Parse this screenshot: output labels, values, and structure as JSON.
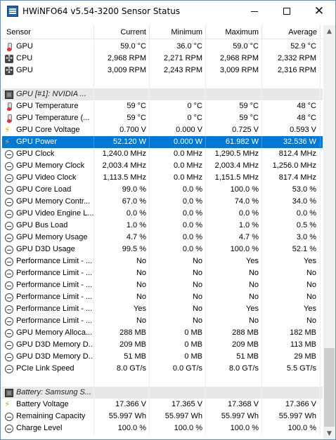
{
  "window": {
    "title": "HWiNFO64 v5.54-3200 Sensor Status"
  },
  "columns": {
    "sensor": "Sensor",
    "current": "Current",
    "minimum": "Minimum",
    "maximum": "Maximum",
    "average": "Average"
  },
  "rows": [
    {
      "type": "data",
      "icon": "thermometer-icon",
      "name": "GPU",
      "current": "59.0 °C",
      "minimum": "36.0 °C",
      "maximum": "59.0 °C",
      "average": "52.9 °C"
    },
    {
      "type": "data",
      "icon": "fan-icon",
      "name": "CPU",
      "current": "2,968 RPM",
      "minimum": "2,271 RPM",
      "maximum": "2,968 RPM",
      "average": "2,332 RPM"
    },
    {
      "type": "data",
      "icon": "fan-icon",
      "name": "GPU",
      "current": "3,009 RPM",
      "minimum": "2,243 RPM",
      "maximum": "3,009 RPM",
      "average": "2,316 RPM"
    },
    {
      "type": "spacer"
    },
    {
      "type": "group",
      "icon": "chip-icon",
      "name": "GPU [#1]: NVIDIA ..."
    },
    {
      "type": "data",
      "icon": "thermometer-icon",
      "name": "GPU Temperature",
      "current": "59 °C",
      "minimum": "0 °C",
      "maximum": "59 °C",
      "average": "48 °C"
    },
    {
      "type": "data",
      "icon": "thermometer-icon",
      "name": "GPU Temperature (...",
      "current": "59 °C",
      "minimum": "0 °C",
      "maximum": "59 °C",
      "average": "48 °C"
    },
    {
      "type": "data",
      "icon": "bolt-icon",
      "name": "GPU Core Voltage",
      "current": "0.700 V",
      "minimum": "0.000 V",
      "maximum": "0.725 V",
      "average": "0.593 V"
    },
    {
      "type": "data",
      "icon": "bolt-icon",
      "name": "GPU Power",
      "current": "52.120 W",
      "minimum": "0.000 W",
      "maximum": "61.982 W",
      "average": "32.536 W",
      "selected": true
    },
    {
      "type": "data",
      "icon": "gauge-icon",
      "name": "GPU Clock",
      "current": "1,240.0 MHz",
      "minimum": "0.0 MHz",
      "maximum": "1,290.5 MHz",
      "average": "812.4 MHz"
    },
    {
      "type": "data",
      "icon": "gauge-icon",
      "name": "GPU Memory Clock",
      "current": "2,003.4 MHz",
      "minimum": "0.0 MHz",
      "maximum": "2,003.4 MHz",
      "average": "1,256.0 MHz"
    },
    {
      "type": "data",
      "icon": "gauge-icon",
      "name": "GPU Video Clock",
      "current": "1,113.5 MHz",
      "minimum": "0.0 MHz",
      "maximum": "1,151.5 MHz",
      "average": "817.4 MHz"
    },
    {
      "type": "data",
      "icon": "gauge-icon",
      "name": "GPU Core Load",
      "current": "99.0 %",
      "minimum": "0.0 %",
      "maximum": "100.0 %",
      "average": "53.0 %"
    },
    {
      "type": "data",
      "icon": "gauge-icon",
      "name": "GPU Memory Contr...",
      "current": "67.0 %",
      "minimum": "0.0 %",
      "maximum": "74.0 %",
      "average": "34.0 %"
    },
    {
      "type": "data",
      "icon": "gauge-icon",
      "name": "GPU Video Engine L...",
      "current": "0.0 %",
      "minimum": "0.0 %",
      "maximum": "0.0 %",
      "average": "0.0 %"
    },
    {
      "type": "data",
      "icon": "gauge-icon",
      "name": "GPU Bus Load",
      "current": "1.0 %",
      "minimum": "0.0 %",
      "maximum": "1.0 %",
      "average": "0.5 %"
    },
    {
      "type": "data",
      "icon": "gauge-icon",
      "name": "GPU Memory Usage",
      "current": "4.7 %",
      "minimum": "0.0 %",
      "maximum": "4.7 %",
      "average": "3.0 %"
    },
    {
      "type": "data",
      "icon": "gauge-icon",
      "name": "GPU D3D Usage",
      "current": "99.5 %",
      "minimum": "0.0 %",
      "maximum": "100.0 %",
      "average": "52.1 %"
    },
    {
      "type": "data",
      "icon": "gauge-icon",
      "name": "Performance Limit - ...",
      "current": "No",
      "minimum": "No",
      "maximum": "Yes",
      "average": "Yes"
    },
    {
      "type": "data",
      "icon": "gauge-icon",
      "name": "Performance Limit - ...",
      "current": "No",
      "minimum": "No",
      "maximum": "No",
      "average": "No"
    },
    {
      "type": "data",
      "icon": "gauge-icon",
      "name": "Performance Limit - ...",
      "current": "No",
      "minimum": "No",
      "maximum": "No",
      "average": "No"
    },
    {
      "type": "data",
      "icon": "gauge-icon",
      "name": "Performance Limit - ...",
      "current": "No",
      "minimum": "No",
      "maximum": "No",
      "average": "No"
    },
    {
      "type": "data",
      "icon": "gauge-icon",
      "name": "Performance Limit - ...",
      "current": "Yes",
      "minimum": "No",
      "maximum": "Yes",
      "average": "Yes"
    },
    {
      "type": "data",
      "icon": "gauge-icon",
      "name": "Performance Limit - ...",
      "current": "No",
      "minimum": "No",
      "maximum": "No",
      "average": "No"
    },
    {
      "type": "data",
      "icon": "gauge-icon",
      "name": "GPU Memory Alloca...",
      "current": "288 MB",
      "minimum": "0 MB",
      "maximum": "288 MB",
      "average": "182 MB"
    },
    {
      "type": "data",
      "icon": "gauge-icon",
      "name": "GPU D3D Memory D...",
      "current": "209 MB",
      "minimum": "0 MB",
      "maximum": "209 MB",
      "average": "113 MB"
    },
    {
      "type": "data",
      "icon": "gauge-icon",
      "name": "GPU D3D Memory D...",
      "current": "51 MB",
      "minimum": "0 MB",
      "maximum": "51 MB",
      "average": "29 MB"
    },
    {
      "type": "data",
      "icon": "gauge-icon",
      "name": "PCIe Link Speed",
      "current": "8.0 GT/s",
      "minimum": "0.0 GT/s",
      "maximum": "8.0 GT/s",
      "average": "5.5 GT/s"
    },
    {
      "type": "spacer"
    },
    {
      "type": "group",
      "icon": "chip-icon",
      "name": "Battery: Samsung S..."
    },
    {
      "type": "data",
      "icon": "bolt-icon",
      "name": "Battery Voltage",
      "current": "17.366 V",
      "minimum": "17.365 V",
      "maximum": "17.368 V",
      "average": "17.366 V"
    },
    {
      "type": "data",
      "icon": "gauge-icon",
      "name": "Remaining Capacity",
      "current": "55.997 Wh",
      "minimum": "55.997 Wh",
      "maximum": "55.997 Wh",
      "average": "55.997 Wh"
    },
    {
      "type": "data",
      "icon": "gauge-icon",
      "name": "Charge Level",
      "current": "100.0 %",
      "minimum": "100.0 %",
      "maximum": "100.0 %",
      "average": "100.0 %"
    }
  ]
}
